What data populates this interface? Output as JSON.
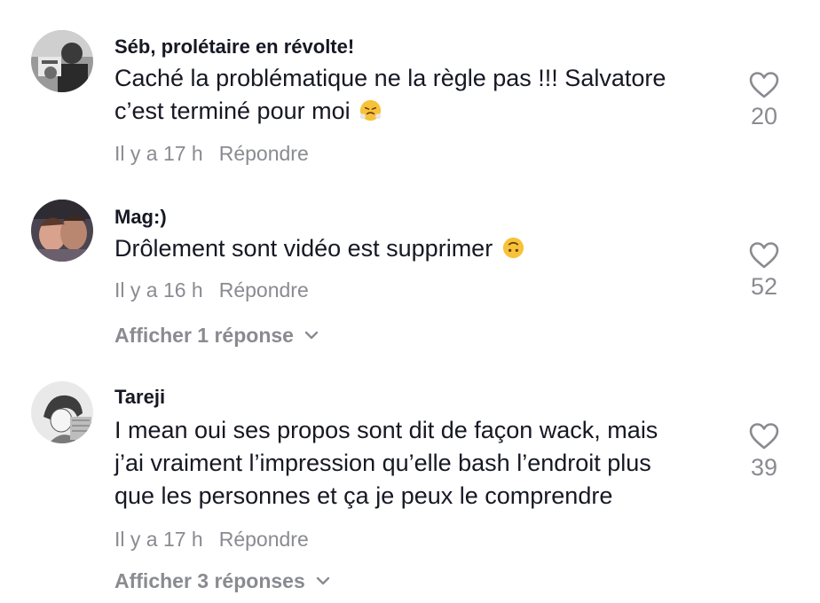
{
  "comments": [
    {
      "username": "Séb, prolétaire en révolte!",
      "text_line1": "Caché la problématique ne la règle pas !!! Salvatore",
      "text_line2": "c’est terminé pour moi",
      "emoji": "face-with-steam-emoji",
      "time": "Il y a 17 h",
      "reply_label": "Répondre",
      "likes": "20",
      "avatar": "user-avatar-photo"
    },
    {
      "username": "Mag:)",
      "text_line1": "Drôlement sont vidéo est supprimer",
      "emoji": "upside-down-face-emoji",
      "time": "Il y a 16 h",
      "reply_label": "Répondre",
      "likes": "52",
      "view_replies": "Afficher 1 réponse",
      "avatar": "user-avatar-photo"
    },
    {
      "username": "Tareji",
      "text_line1": "I mean oui ses propos sont dit de façon wack, mais",
      "text_line2": "j’ai vraiment l’impression qu’elle bash l’endroit plus",
      "text_line3": "que les personnes et ça je peux le comprendre",
      "time": "Il y a 17 h",
      "reply_label": "Répondre",
      "likes": "39",
      "view_replies": "Afficher 3 réponses",
      "avatar": "user-avatar-drawing"
    }
  ],
  "icons": {
    "like": "heart-outline-icon",
    "expand": "chevron-down-icon"
  },
  "colors": {
    "text": "#161823",
    "secondary": "#8a8b91"
  }
}
